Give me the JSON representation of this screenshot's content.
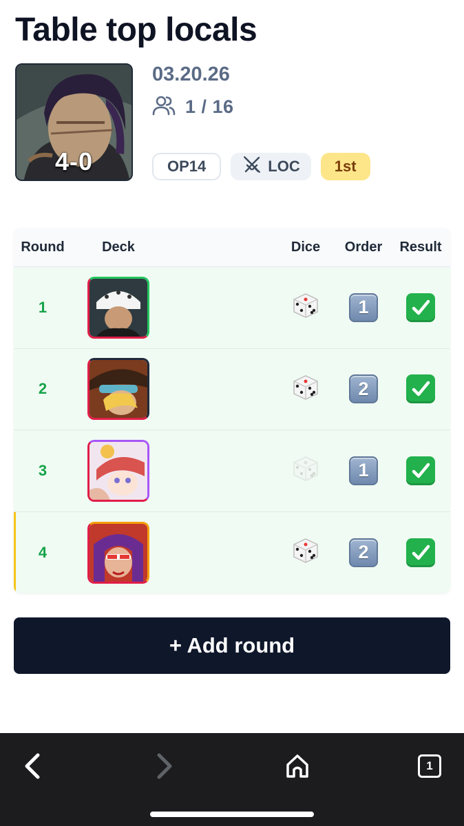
{
  "event": {
    "title": "Table top locals",
    "date": "03.20.26",
    "players": "1 / 16",
    "record": "4-0",
    "badges": {
      "set": "OP14",
      "format": "LOC",
      "placement": "1st"
    }
  },
  "table": {
    "headers": {
      "round": "Round",
      "deck": "Deck",
      "dice": "Dice",
      "order": "Order",
      "result": "Result"
    },
    "rows": [
      {
        "round": "1",
        "deck_colors": [
          "#e11d48",
          "#22c55e"
        ],
        "dice": "won",
        "order": "1",
        "result": "win"
      },
      {
        "round": "2",
        "deck_colors": [
          "#e11d48",
          "#1e293b"
        ],
        "dice": "won",
        "order": "2",
        "result": "win"
      },
      {
        "round": "3",
        "deck_colors": [
          "#e11d48",
          "#a855f7"
        ],
        "dice": "lost",
        "order": "1",
        "result": "win"
      },
      {
        "round": "4",
        "deck_colors": [
          "#e11d48",
          "#f59e0b"
        ],
        "dice": "won",
        "order": "2",
        "result": "win"
      }
    ]
  },
  "actions": {
    "add_round": "+ Add round"
  },
  "browser": {
    "tab_count": "1"
  },
  "colors": {
    "accent_dark": "#0f172a",
    "win_green": "#16a34a",
    "row_bg": "#f0fbf3",
    "active_marker": "#f5c518",
    "placement_badge": "#fde68a"
  }
}
